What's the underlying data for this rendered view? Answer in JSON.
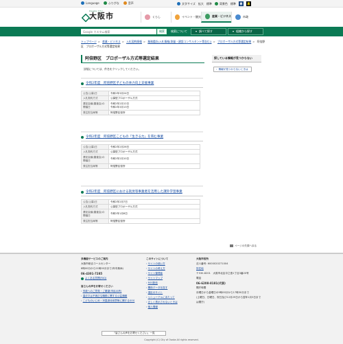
{
  "utility": {
    "language": "Language",
    "furigana": "ふりがな",
    "speech": "音声",
    "text_size_label": "文字サイズ",
    "enlarge": "拡大",
    "standard": "標準",
    "color_label": "背景色",
    "color_standard": "標準",
    "color_blue": "青",
    "color_black": "黒"
  },
  "header": {
    "logo_sub": "Osaka City",
    "logo_text": "大阪市",
    "nav": [
      {
        "label": "くらし"
      },
      {
        "label": "イベント・観光"
      },
      {
        "label": "産業・ビジネス"
      },
      {
        "label": "市政"
      }
    ]
  },
  "searchbar": {
    "placeholder": "Google カスタム検索",
    "button": "検索",
    "search_help": "検索について",
    "pill_left": "調べて探す",
    "pill_right": "組織から探す"
  },
  "breadcrumb": [
    "トップページ",
    "産業・ビジネス",
    "入札契約情報",
    "業務委託(入札情報(測量・建設コンサルタント等含む))",
    "プロポーザル方式等選定結果",
    "阿倍野区　プロポーザル方式等選定結果"
  ],
  "page": {
    "title": "阿倍野区　プロポーザル方式等選定結果",
    "intro": "詳細については、件名をクリックしてください。"
  },
  "sections": [
    {
      "title": "令和2年度　阿倍野区子どもの体力向上支援事業",
      "rows": [
        {
          "label": "公告(公募)日",
          "value": "令和2年3月24日"
        },
        {
          "label": "入札契約方式",
          "value": "公募型プロポーザル方式"
        },
        {
          "label": "選定会議(審査会)の開催日",
          "value": "令和2年2月12日\n令和2年3月13日"
        },
        {
          "label": "発注担当局等",
          "value": "阿倍野区役所"
        }
      ]
    },
    {
      "title": "令和2年度　阿倍野区こどもの「生きる力」を育む事業",
      "rows": [
        {
          "label": "公告(公募)日",
          "value": "令和2年2月26日"
        },
        {
          "label": "入札契約方式",
          "value": "公募型プロポーザル方式"
        },
        {
          "label": "選定会議(審査会)の開催日",
          "value": "令和2年2月10日"
        },
        {
          "label": "発注担当局等",
          "value": "阿倍野区役所"
        }
      ]
    },
    {
      "title": "令和2年度　阿倍野区における就労等事業者を活用した課外学習事業",
      "rows": [
        {
          "label": "公告(公募)日",
          "value": "令和2年2月7日"
        },
        {
          "label": "入札契約方式",
          "value": "公募型プロポーザル方式"
        },
        {
          "label": "選定会議(審査会)の開催日",
          "value": "令和2年1月6日"
        },
        {
          "label": "発注担当局等",
          "value": "阿倍野区役所"
        }
      ]
    }
  ],
  "sidebar": {
    "heading": "探している情報が見つからない",
    "button": "情報が見つからないときは"
  },
  "pagetop": "ページの先頭へ戻る",
  "footer": {
    "col1": {
      "heading": "多機能サービスのご案内",
      "line1": "大阪市総合コールセンター",
      "line2": "8時00分から21時00分まで(年中無休)",
      "tel": "06-4301-7285",
      "faq": "よくある質問(FAQ)",
      "voice_heading": "皆さんの声をお寄せください",
      "links": [
        "市政へのご意見・ご要望(市民の声)",
        "違法又は不適正な職務に関する公益通報",
        "こどものいじめ・児童虐待体罰等に関するSOS"
      ]
    },
    "col2": {
      "heading": "このサイトについて",
      "links": [
        "サイトの使い方",
        "サイトの考え方",
        "サイト管理者",
        "サイトマップ",
        "RSS配信",
        "関係データを探す",
        "違反のサイト",
        "リニューアルにあたって",
        "正しく表示されないときは",
        "個人情報"
      ]
    },
    "col3": {
      "heading": "大阪市役所",
      "corp_no": "法人番号: 6000020271004",
      "access": "所在地",
      "address": "〒530-8201　大阪市北区中之島1丁目3番20号",
      "tel_label": "電話",
      "tel": "06-6208-8181(代表)",
      "hours_label": "開庁時間",
      "hours1": "月曜日から金曜日の9時00分から17時30分まで",
      "hours2": "(土曜日、日曜日、祝日及び12月29日から翌年1月3日までは閉庁)"
    },
    "voice_button": "「皆さんの声をお寄せください」一覧",
    "copyright": "Copyright (C) City of Osaka All rights reserved."
  }
}
